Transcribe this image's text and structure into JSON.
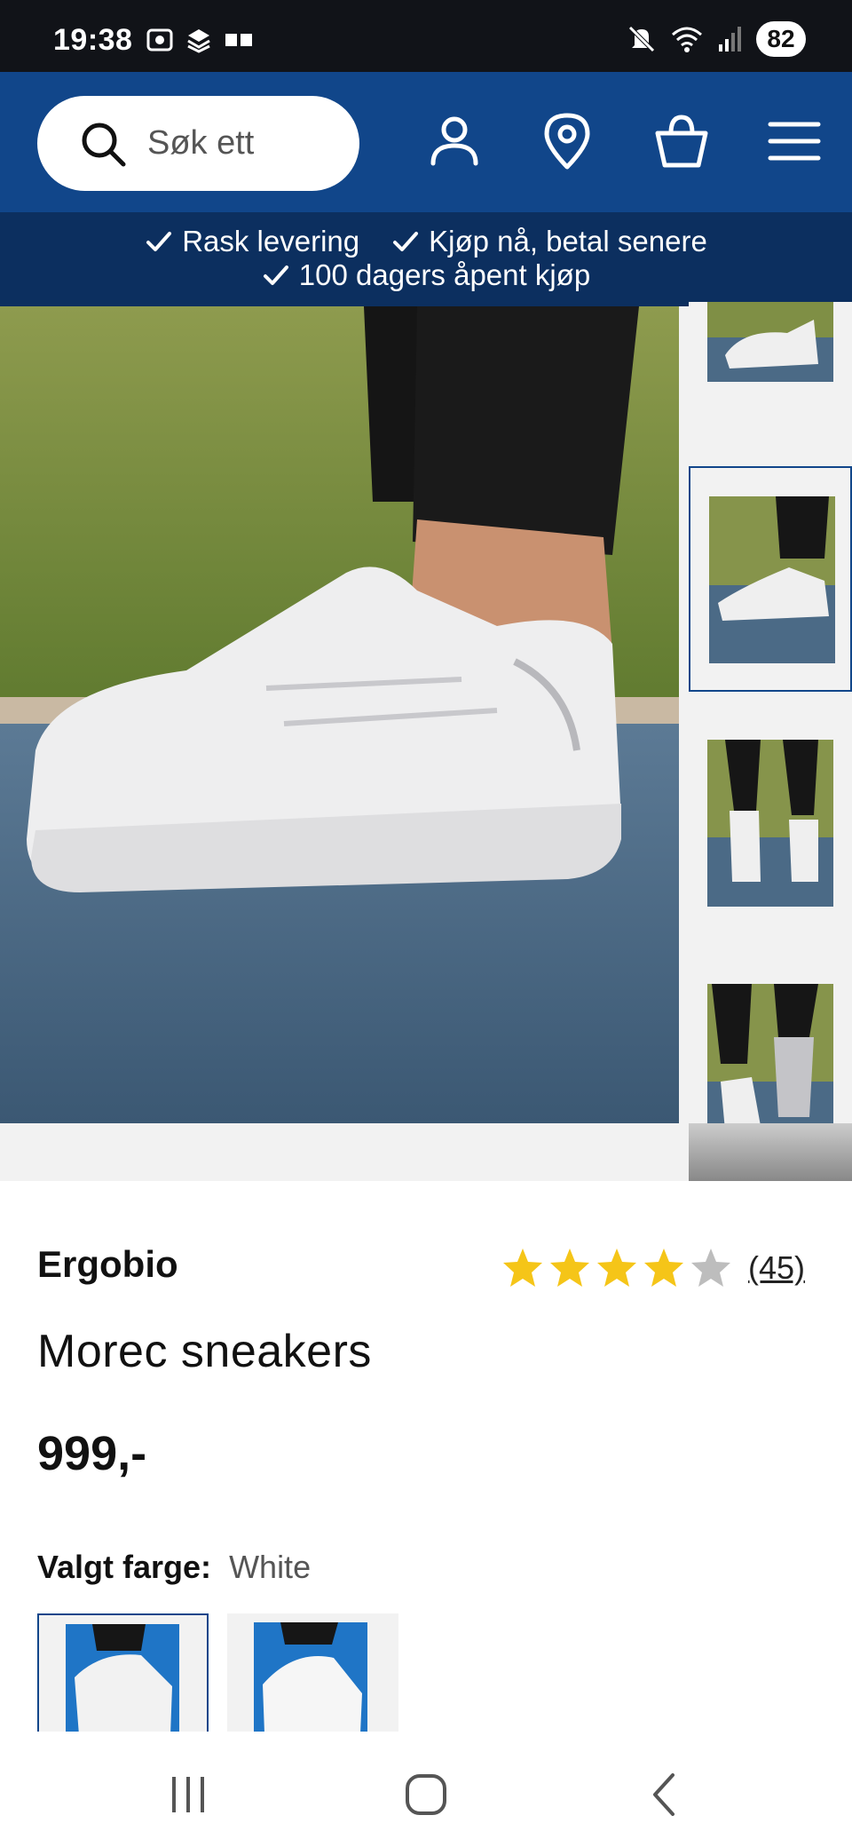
{
  "status_bar": {
    "time": "19:38",
    "battery": "82"
  },
  "header": {
    "search_placeholder": "Søk ett",
    "icons": [
      "search-icon",
      "user-icon",
      "location-icon",
      "cart-icon",
      "menu-icon"
    ],
    "background": "#11468a"
  },
  "usp": {
    "items": [
      "Rask levering",
      "Kjøp nå, betal senere",
      "100 dagers åpent kjøp"
    ],
    "background": "#0c2f5f"
  },
  "product": {
    "brand": "Ergobio",
    "rating": 4,
    "rating_max": 5,
    "review_count": "(45)",
    "title": "Morec sneakers",
    "price": "999,-",
    "color_label": "Valgt farge:",
    "color_value": "White"
  },
  "gallery": {
    "thumb_count": 4,
    "selected_thumb": 2
  },
  "colors": {
    "accent": "#11468a",
    "star": "#f5c518",
    "star_empty": "#bdbdbd"
  }
}
